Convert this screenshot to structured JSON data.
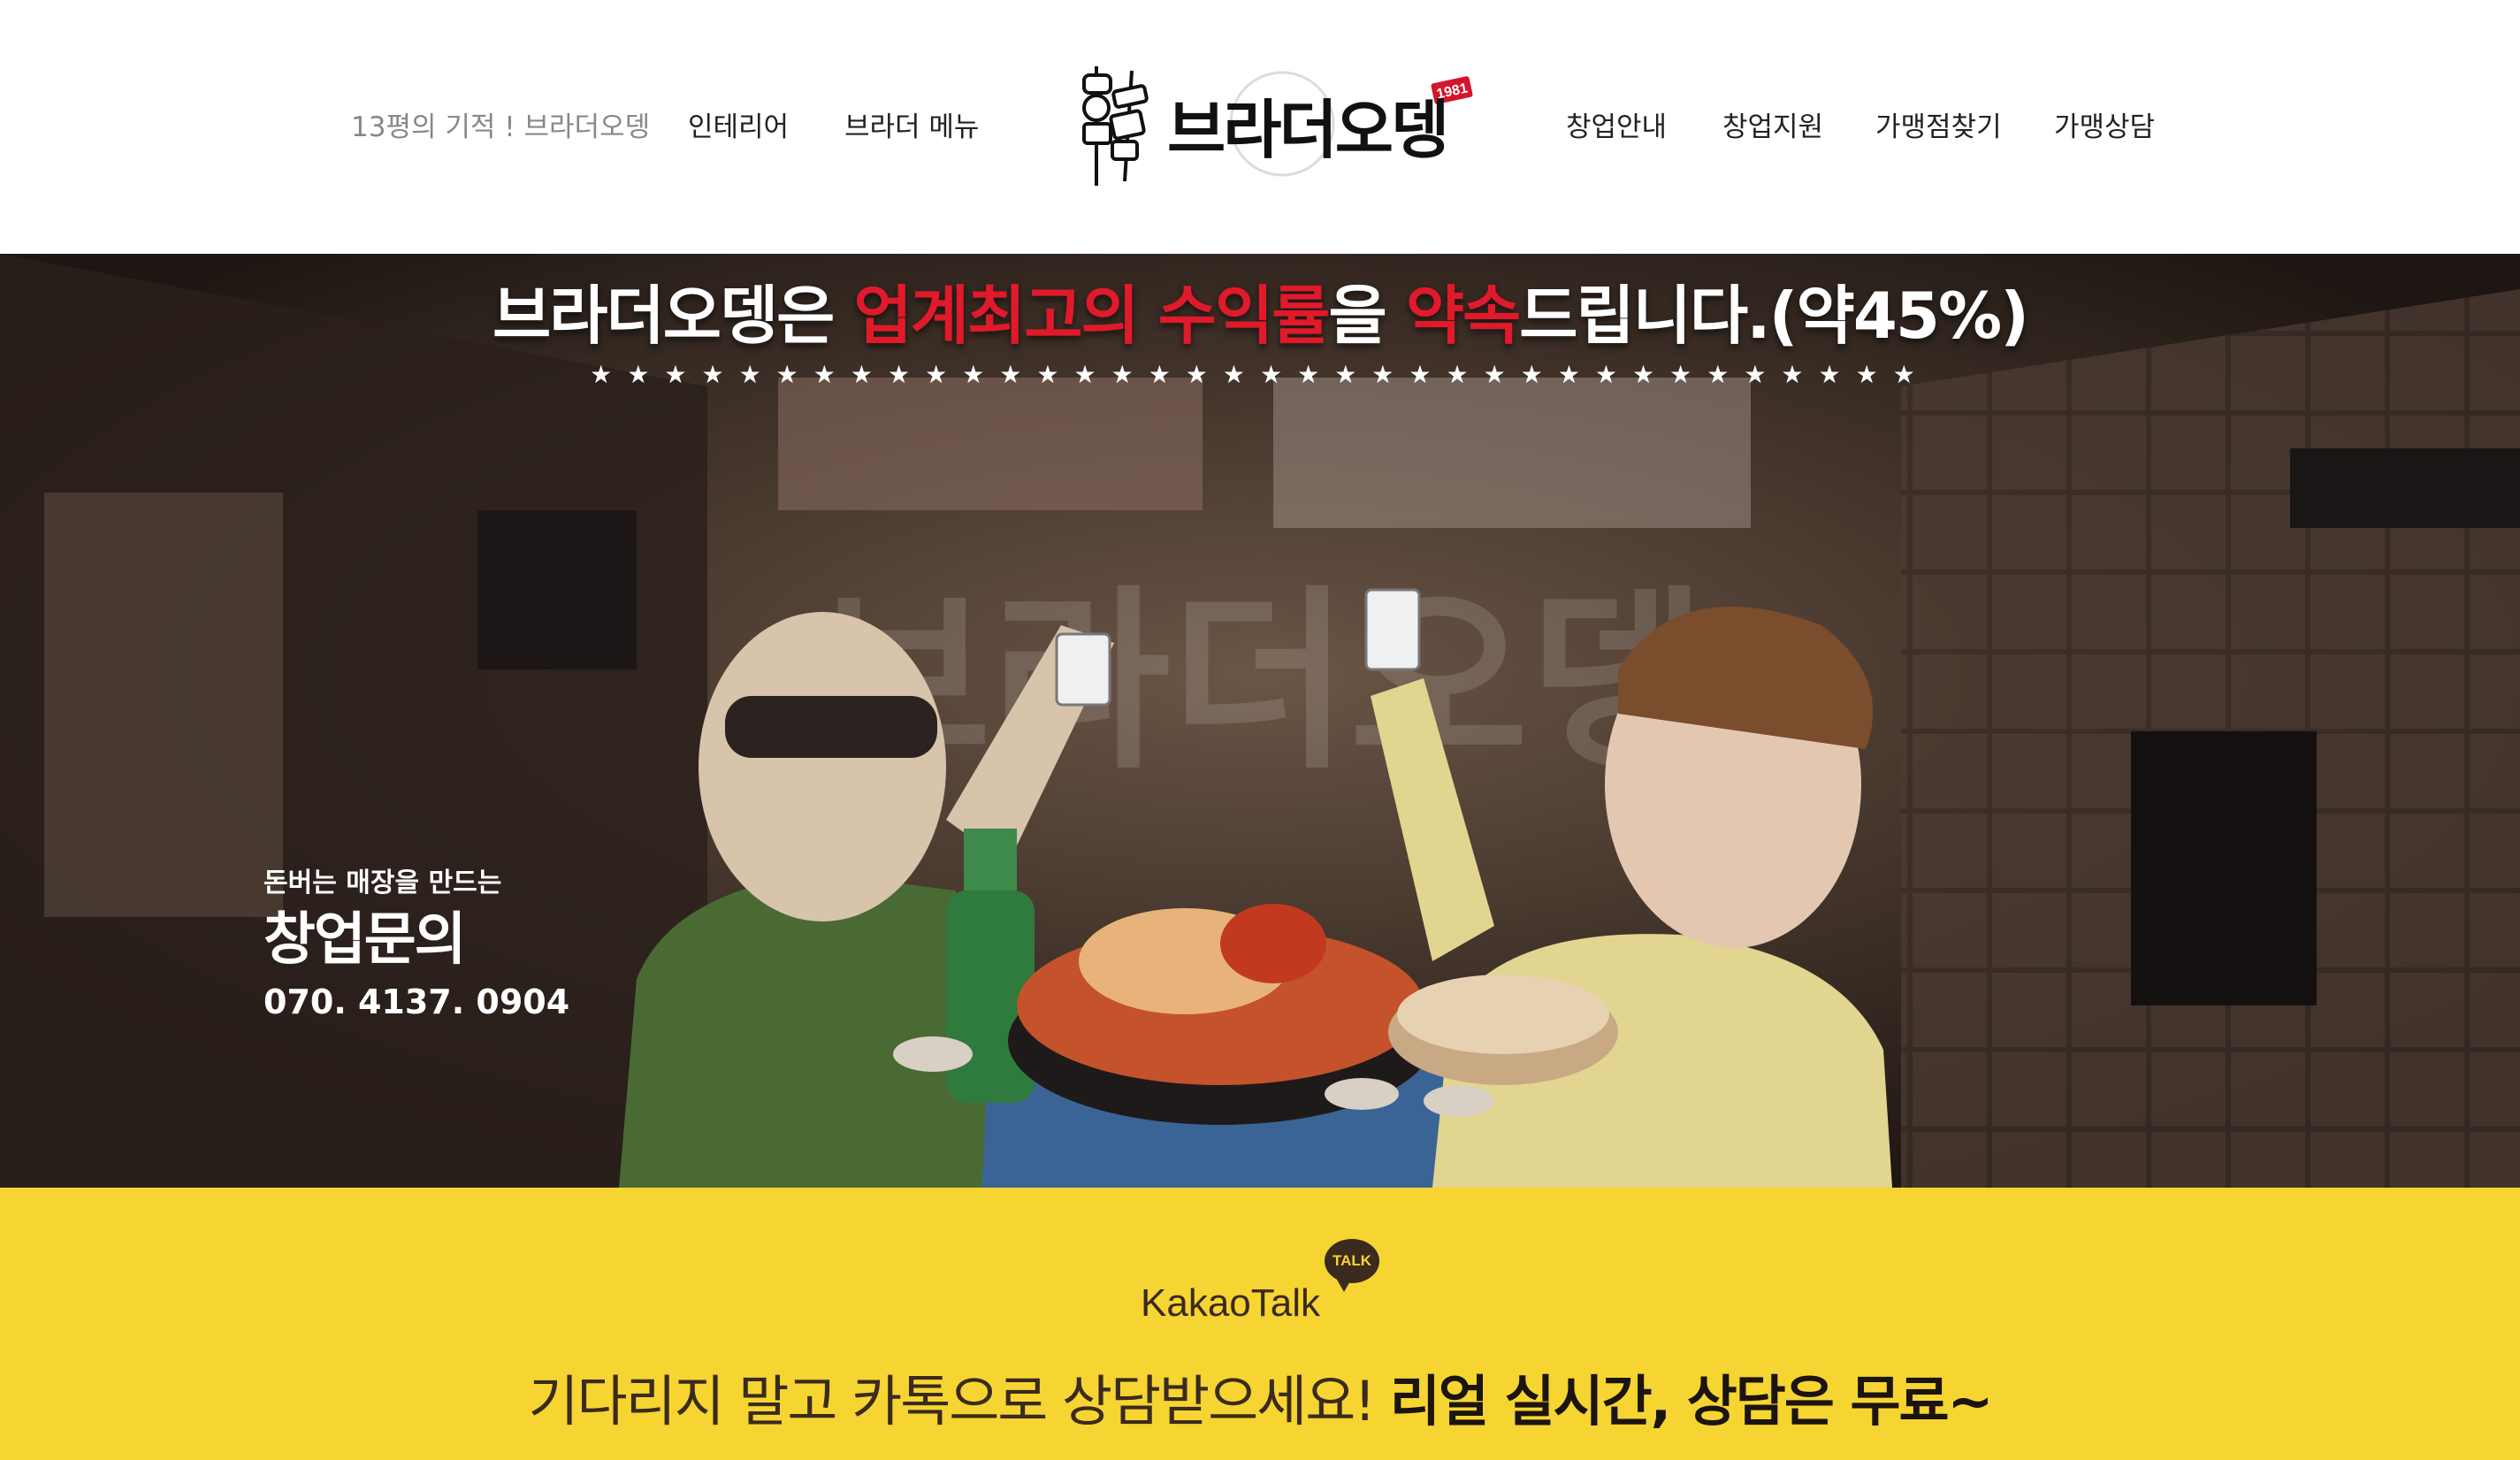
{
  "header": {
    "nav_left": [
      "13평의 기적 ! 브라더오뎅",
      "인테리어",
      "브라더 메뉴"
    ],
    "logo": {
      "text": "브라더오뎅",
      "badge": "1981"
    },
    "nav_right": [
      "창업안내",
      "창업지원",
      "가맹점찾기",
      "가맹상담"
    ]
  },
  "hero": {
    "headline_parts": [
      "브라더오뎅은 ",
      "업계최고의 수익률",
      "을 ",
      "약속",
      "드립니다.(약45%)"
    ],
    "stars": "★★★★★★★★★★★★★★★★★★★★★★★★★★★★★★★★★★★★",
    "contact": {
      "subtitle": "돈버는 매장을 만드는",
      "title": "창업문의",
      "phone": "070. 4137. 0904"
    },
    "colors": {
      "accent_red": "#e01a2b",
      "text": "#ffffff"
    }
  },
  "kakao": {
    "brand": "KakaoTalk",
    "badge": "TALK",
    "message_regular": "기다리지 말고 카톡으로 상담받으세요! ",
    "message_bold": "리얼 실시간, 상담은 무료~",
    "colors": {
      "background": "#f6d532",
      "text": "#3b2a1e"
    }
  }
}
